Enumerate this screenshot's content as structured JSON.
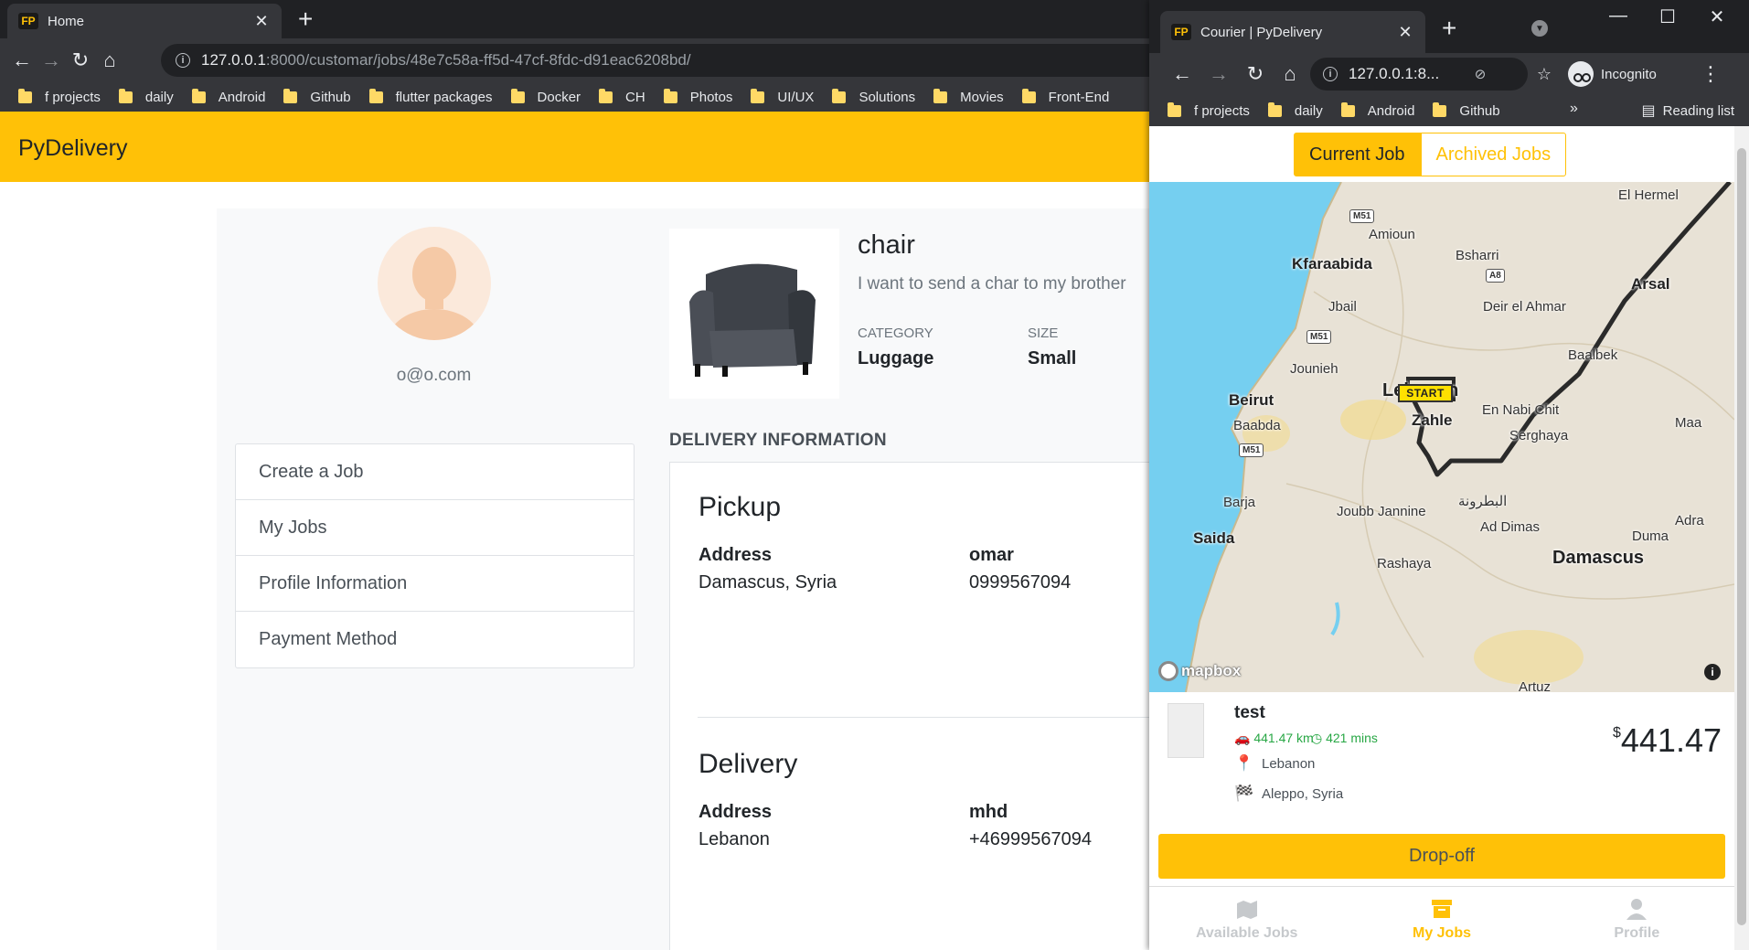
{
  "main_window": {
    "tab": {
      "favicon": "FP",
      "title": "Home",
      "close": "✕"
    },
    "new_tab": "+",
    "url": {
      "host": "127.0.0.1",
      "path": ":8000/customar/jobs/48e7c58a-ff5d-47cf-8fdc-d91eac6208bd/"
    },
    "bookmarks": [
      "f projects",
      "daily",
      "Android",
      "Github",
      "flutter packages",
      "Docker",
      "CH",
      "Photos",
      "UI/UX",
      "Solutions",
      "Movies",
      "Front-End"
    ],
    "brand": "PyDelivery",
    "user_email": "o@o.com",
    "menu": [
      "Create a Job",
      "My Jobs",
      "Profile Information",
      "Payment Method"
    ],
    "job": {
      "title": "chair",
      "description": "I want to send a char to my brother",
      "category_label": "CATEGORY",
      "category": "Luggage",
      "size_label": "SIZE",
      "size": "Small"
    },
    "delivery_heading": "DELIVERY INFORMATION",
    "pickup": {
      "title": "Pickup",
      "address_label": "Address",
      "address": "Damascus, Syria",
      "contact_name": "omar",
      "contact_phone": "0999567094"
    },
    "delivery": {
      "title": "Delivery",
      "address_label": "Address",
      "address": "Lebanon",
      "contact_name": "mhd",
      "contact_phone": "+46999567094"
    }
  },
  "courier_window": {
    "tab": {
      "favicon": "FP",
      "title": "Courier | PyDelivery",
      "close": "✕"
    },
    "new_tab": "+",
    "window_controls": {
      "minimize": "—",
      "maximize": "☐",
      "close": "✕"
    },
    "url": "127.0.0.1:8...",
    "incognito_label": "Incognito",
    "bookmarks": [
      "f projects",
      "daily",
      "Android",
      "Github"
    ],
    "bookmarks_more": "»",
    "reading_list": "Reading list",
    "job_tabs": {
      "current": "Current Job",
      "archived": "Archived Jobs"
    },
    "map": {
      "start_label": "START",
      "attribution": "mapbox",
      "info": "i",
      "places": {
        "el_hermel": "El Hermel",
        "amioun": "Amioun",
        "kfaraabida": "Kfaraabida",
        "bsharri": "Bsharri",
        "arsal": "Arsal",
        "jbail": "Jbail",
        "deir_el_ahmar": "Deir el Ahmar",
        "baalbek": "Baalbek",
        "jounieh": "Jounieh",
        "lebanon": "Lebanon",
        "beirut": "Beirut",
        "zahle": "Zahle",
        "en_nabi_chit": "En Nabi Chit",
        "maa": "Maa",
        "baabda": "Baabda",
        "serghaya": "Serghaya",
        "barja": "Barja",
        "joubb_jannine": "Joubb Jannine",
        "btroun_ar": "البطرونة",
        "adra": "Adra",
        "saida": "Saida",
        "ad_dimas": "Ad Dimas",
        "duma": "Duma",
        "damascus": "Damascus",
        "rashaya": "Rashaya",
        "artuz": "Artuz"
      },
      "shields": {
        "m51_a": "M51",
        "a8": "A8",
        "m51_b": "M51",
        "m51_c": "M51"
      }
    },
    "job": {
      "name": "test",
      "distance": "441.47 km",
      "duration": "421 mins",
      "pickup": "Lebanon",
      "dropoff": "Aleppo, Syria",
      "currency": "$",
      "price": "441.47"
    },
    "action_button": "Drop-off",
    "bottom_nav": [
      "Available Jobs",
      "My Jobs",
      "Profile"
    ],
    "colors": {
      "accent": "#ffc107",
      "green": "#28a745",
      "water": "#75cff0"
    }
  }
}
